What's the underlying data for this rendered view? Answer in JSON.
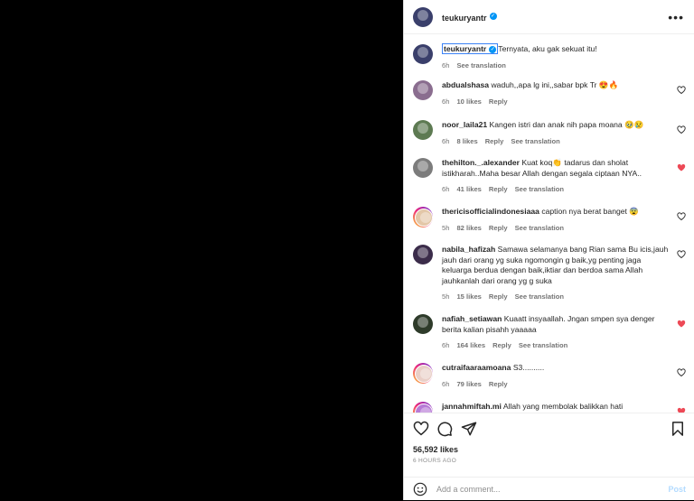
{
  "post_author": {
    "username": "teukuryantr",
    "verified": true
  },
  "caption": {
    "username": "teukuryantr",
    "text": "Ternyata, aku gak sekuat itu!",
    "time": "6h",
    "translate": "See translation"
  },
  "comments": [
    {
      "username": "abdualshasa",
      "text": "waduh,,apa lg ini,,sabar bpk Tr 😍🔥",
      "time": "6h",
      "likes": "10 likes",
      "reply": "Reply",
      "translate": "",
      "liked": false,
      "avatar_color": "#8a6d8f"
    },
    {
      "username": "noor_laila21",
      "text": "Kangen istri dan anak nih papa moana 🥹😢",
      "time": "6h",
      "likes": "8 likes",
      "reply": "Reply",
      "translate": "See translation",
      "liked": false,
      "avatar_color": "#5d7a52"
    },
    {
      "username": "thehilton._.alexander",
      "text": "Kuat koq👏 tadarus dan sholat istikharah..Maha besar Allah dengan segala ciptaan NYA..",
      "time": "6h",
      "likes": "41 likes",
      "reply": "Reply",
      "translate": "See translation",
      "liked": true,
      "avatar_color": "#7c7c7c"
    },
    {
      "username": "thericisofficialindonesiaaa",
      "text": "caption nya berat banget 😨",
      "time": "5h",
      "likes": "82 likes",
      "reply": "Reply",
      "translate": "See translation",
      "liked": false,
      "avatar_color": "#e3c7a8",
      "ring": true
    },
    {
      "username": "nabila_hafizah",
      "text": "Samawa selamanya bang Rian sama Bu icis,jauh jauh dari orang yg suka ngomongin g baik,yg penting jaga keluarga berdua dengan baik,iktiar dan berdoa sama Allah jauhkanlah dari orang yg g suka",
      "time": "5h",
      "likes": "15 likes",
      "reply": "Reply",
      "translate": "See translation",
      "liked": false,
      "avatar_color": "#3b2c4a"
    },
    {
      "username": "nafiah_setiawan",
      "text": "Kuaatt insyaallah. Jngan smpen sya denger berita kalian pisahh yaaaaa",
      "time": "6h",
      "likes": "164 likes",
      "reply": "Reply",
      "translate": "See translation",
      "liked": true,
      "avatar_color": "#2e3b2a"
    },
    {
      "username": "cutraifaaraamoana",
      "text": "S3..........",
      "time": "6h",
      "likes": "79 likes",
      "reply": "Reply",
      "translate": "",
      "liked": false,
      "avatar_color": "#e9cfc7",
      "ring": true
    },
    {
      "username": "jannahmiftah.mi",
      "text": "Allah yang membolak balikkan hati",
      "time": "",
      "likes": "",
      "reply": "",
      "translate": "",
      "liked": true,
      "avatar_color": "#b77ad6",
      "ring": true
    }
  ],
  "footer": {
    "likes": "56,592 likes",
    "ago": "6 HOURS AGO"
  },
  "add_comment": {
    "placeholder": "Add a comment...",
    "post_label": "Post"
  },
  "colors": {
    "link": "#0095f6",
    "like_red": "#ed4956",
    "text": "#262626",
    "muted": "#737373"
  },
  "icons": [
    "more-icon",
    "heart-icon",
    "comment-icon",
    "share-icon",
    "bookmark-icon",
    "emoji-icon",
    "verified-icon"
  ]
}
